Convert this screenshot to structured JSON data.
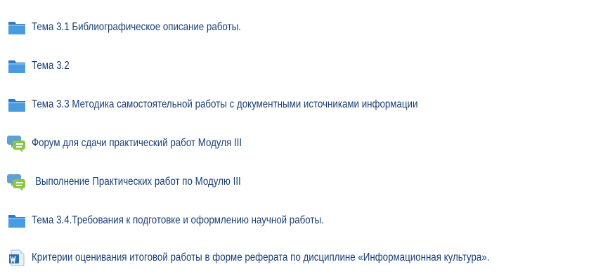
{
  "items": [
    {
      "icon": "folder-icon",
      "label": "Тема 3.1 Библиографическое описание работы."
    },
    {
      "icon": "folder-icon",
      "label": "Тема 3.2"
    },
    {
      "icon": "folder-icon",
      "label": "Тема 3.3 Методика самостоятельной работы с документными источниками информации"
    },
    {
      "icon": "forum-icon",
      "label": "Форум для сдачи практический работ Модуля III"
    },
    {
      "icon": "forum-icon",
      "label": "Выполнение Практических работ по Модулю III"
    },
    {
      "icon": "folder-icon",
      "label": "Тема 3.4.Требования к подготовке и оформлению научной работы."
    },
    {
      "icon": "word-document-icon",
      "label": "Критерии оценивания итоговой работы в форме реферата по дисциплине «Информационная культура»."
    }
  ],
  "colors": {
    "link": "#1a3f73",
    "folder": "#3e8fd6",
    "forum_bubble": "#8bc63e",
    "forum_bubble_back": "#5fa0d8",
    "word_icon": "#2a6fb3"
  }
}
